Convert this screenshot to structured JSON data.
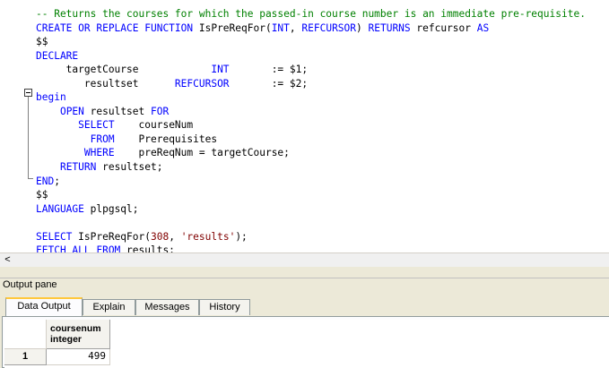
{
  "editor": {
    "lines": [
      {
        "segs": [
          {
            "t": "-- Returns the courses for which the passed-in course number is an immediate pre-requisite.",
            "c": "cm"
          }
        ]
      },
      {
        "segs": [
          {
            "t": "CREATE OR REPLACE FUNCTION ",
            "c": "kw"
          },
          {
            "t": "IsPreReqFor(",
            "c": "tx"
          },
          {
            "t": "INT",
            "c": "kw"
          },
          {
            "t": ", ",
            "c": "tx"
          },
          {
            "t": "REFCURSOR",
            "c": "kw"
          },
          {
            "t": ") ",
            "c": "tx"
          },
          {
            "t": "RETURNS",
            "c": "kw"
          },
          {
            "t": " refcursor ",
            "c": "tx"
          },
          {
            "t": "AS",
            "c": "kw"
          }
        ]
      },
      {
        "segs": [
          {
            "t": "$$",
            "c": "tx"
          }
        ]
      },
      {
        "segs": [
          {
            "t": "DECLARE",
            "c": "kw"
          }
        ]
      },
      {
        "segs": [
          {
            "t": "     targetCourse            ",
            "c": "tx"
          },
          {
            "t": "INT",
            "c": "kw"
          },
          {
            "t": "       := $1;",
            "c": "tx"
          }
        ]
      },
      {
        "segs": [
          {
            "t": "        resultset      ",
            "c": "tx"
          },
          {
            "t": "REFCURSOR",
            "c": "kw"
          },
          {
            "t": "       := $2;",
            "c": "tx"
          }
        ]
      },
      {
        "segs": [
          {
            "t": "begin",
            "c": "kw"
          }
        ]
      },
      {
        "segs": [
          {
            "t": "    ",
            "c": "tx"
          },
          {
            "t": "OPEN",
            "c": "kw"
          },
          {
            "t": " resultset ",
            "c": "tx"
          },
          {
            "t": "FOR",
            "c": "kw"
          }
        ]
      },
      {
        "segs": [
          {
            "t": "       ",
            "c": "tx"
          },
          {
            "t": "SELECT",
            "c": "kw"
          },
          {
            "t": "    courseNum",
            "c": "tx"
          }
        ]
      },
      {
        "segs": [
          {
            "t": "         ",
            "c": "tx"
          },
          {
            "t": "FROM",
            "c": "kw"
          },
          {
            "t": "    Prerequisites",
            "c": "tx"
          }
        ]
      },
      {
        "segs": [
          {
            "t": "        ",
            "c": "tx"
          },
          {
            "t": "WHERE",
            "c": "kw"
          },
          {
            "t": "    preReqNum = targetCourse;",
            "c": "tx"
          }
        ]
      },
      {
        "segs": [
          {
            "t": "    ",
            "c": "tx"
          },
          {
            "t": "RETURN",
            "c": "kw"
          },
          {
            "t": " resultset;",
            "c": "tx"
          }
        ]
      },
      {
        "segs": [
          {
            "t": "END",
            "c": "kw"
          },
          {
            "t": ";",
            "c": "tx"
          }
        ]
      },
      {
        "segs": [
          {
            "t": "$$",
            "c": "tx"
          }
        ]
      },
      {
        "segs": [
          {
            "t": "LANGUAGE",
            "c": "kw"
          },
          {
            "t": " plpgsql;",
            "c": "tx"
          }
        ]
      },
      {
        "segs": [
          {
            "t": "",
            "c": "tx"
          }
        ]
      },
      {
        "segs": [
          {
            "t": "SELECT",
            "c": "kw"
          },
          {
            "t": " IsPreReqFor(",
            "c": "tx"
          },
          {
            "t": "308",
            "c": "num"
          },
          {
            "t": ", ",
            "c": "tx"
          },
          {
            "t": "'results'",
            "c": "str"
          },
          {
            "t": ");",
            "c": "tx"
          }
        ]
      },
      {
        "segs": [
          {
            "t": "FETCH ALL FROM",
            "c": "kw"
          },
          {
            "t": " results;",
            "c": "tx"
          }
        ]
      }
    ]
  },
  "scrollbar": {
    "left_arrow": "<"
  },
  "output_pane": {
    "title": "Output pane",
    "tabs": [
      "Data Output",
      "Explain",
      "Messages",
      "History"
    ],
    "active_tab": "Data Output",
    "grid": {
      "column": {
        "name": "coursenum",
        "type": "integer"
      },
      "rows": [
        {
          "row_number": "1",
          "value": "499"
        }
      ]
    }
  }
}
